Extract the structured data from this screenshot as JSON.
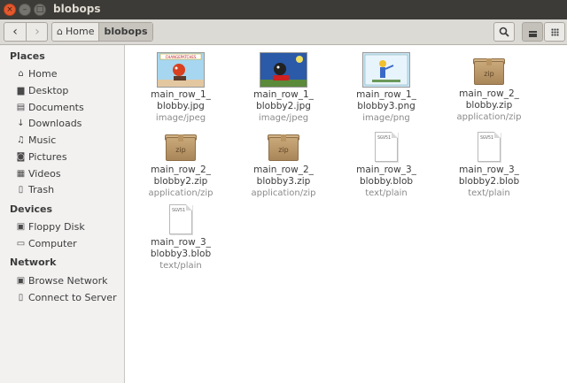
{
  "window": {
    "title": "blobops"
  },
  "toolbar": {
    "breadcrumbs": [
      "Home",
      "blobops"
    ]
  },
  "sidebar": {
    "places_heading": "Places",
    "places": [
      {
        "label": "Home",
        "icon": "home-icon"
      },
      {
        "label": "Desktop",
        "icon": "desktop-icon"
      },
      {
        "label": "Documents",
        "icon": "documents-icon"
      },
      {
        "label": "Downloads",
        "icon": "downloads-icon"
      },
      {
        "label": "Music",
        "icon": "music-icon"
      },
      {
        "label": "Pictures",
        "icon": "pictures-icon"
      },
      {
        "label": "Videos",
        "icon": "videos-icon"
      },
      {
        "label": "Trash",
        "icon": "trash-icon"
      }
    ],
    "devices_heading": "Devices",
    "devices": [
      {
        "label": "Floppy Disk",
        "icon": "floppy-icon"
      },
      {
        "label": "Computer",
        "icon": "computer-icon"
      }
    ],
    "network_heading": "Network",
    "network": [
      {
        "label": "Browse Network",
        "icon": "network-icon"
      },
      {
        "label": "Connect to Server",
        "icon": "server-icon"
      }
    ]
  },
  "files": [
    {
      "name1": "main_row_1_",
      "name2": "blobby.jpg",
      "type": "image/jpeg",
      "icon": "image-thumbnail"
    },
    {
      "name1": "main_row_1_",
      "name2": "blobby2.jpg",
      "type": "image/jpeg",
      "icon": "image-thumbnail"
    },
    {
      "name1": "main_row_1_",
      "name2": "blobby3.png",
      "type": "image/png",
      "icon": "image-thumbnail"
    },
    {
      "name1": "main_row_2_",
      "name2": "blobby.zip",
      "type": "application/zip",
      "icon": "zip-archive-icon",
      "badge": "zip"
    },
    {
      "name1": "main_row_2_",
      "name2": "blobby2.zip",
      "type": "application/zip",
      "icon": "zip-archive-icon",
      "badge": "zip"
    },
    {
      "name1": "main_row_2_",
      "name2": "blobby3.zip",
      "type": "application/zip",
      "icon": "zip-archive-icon",
      "badge": "zip"
    },
    {
      "name1": "main_row_3_",
      "name2": "blobby.blob",
      "type": "text/plain",
      "icon": "text-file-icon",
      "badge": "SGV51"
    },
    {
      "name1": "main_row_3_",
      "name2": "blobby2.blob",
      "type": "text/plain",
      "icon": "text-file-icon",
      "badge": "SGV51"
    },
    {
      "name1": "main_row_3_",
      "name2": "blobby3.blob",
      "type": "text/plain",
      "icon": "text-file-icon",
      "badge": "SGV51"
    }
  ],
  "thumb1_caption": "CHANGEPATCHES"
}
